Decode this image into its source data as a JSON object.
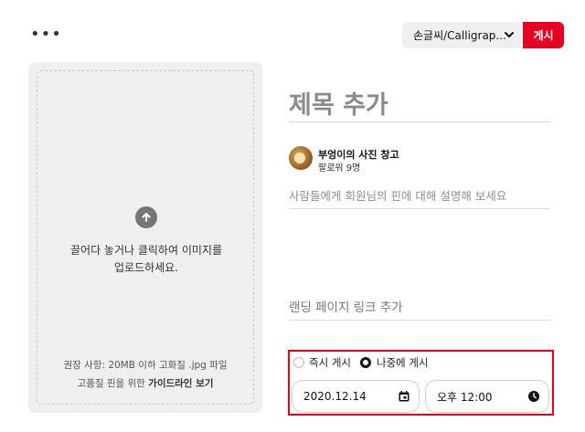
{
  "toolbar": {
    "more_label": "•••"
  },
  "board_select": {
    "value": "손글씨/Calligrap..."
  },
  "publish_button": {
    "label": "게시"
  },
  "upload": {
    "instruction": "끌어다 놓거나 클릭하여 이미지를 업로드하세요.",
    "recommendation": "권장 사항: 20MB 이하 고화질 .jpg 파일",
    "guide_prefix": "고품질 핀을 위한 ",
    "guide_link": "가이드라인 보기"
  },
  "form": {
    "title_placeholder": "제목 추가",
    "user_name": "부엉이의 사진 창고",
    "followers": "팔로워 9명",
    "description_placeholder": "사람들에게 회원님의 핀에 대해 설명해 보세요",
    "link_placeholder": "랜딩 페이지 링크 추가"
  },
  "schedule": {
    "option_now": "즉시 게시",
    "option_later": "나중에 게시",
    "selected": "later",
    "date": "2020.12.14",
    "time": "오후 12:00"
  },
  "colors": {
    "accent": "#e60023",
    "highlight": "#e3001b"
  }
}
